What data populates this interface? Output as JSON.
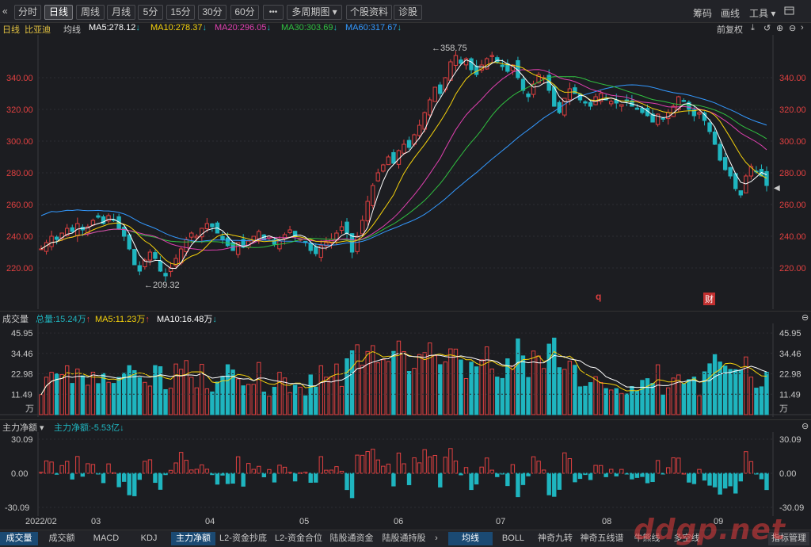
{
  "toolbar": {
    "collapse_icon": "«",
    "periods": [
      "分时",
      "日线",
      "周线",
      "月线",
      "5分",
      "15分",
      "30分",
      "60分"
    ],
    "more_label": "•••",
    "multi_period": "多周期图 ▾",
    "stock_info": "个股资料",
    "diagnose": "诊股",
    "right_tools": [
      "筹码",
      "画线",
      "工具 ▾"
    ]
  },
  "info": {
    "period": "日线",
    "name": "比亚迪",
    "avg": "均线",
    "ma5": "MA5:278.12",
    "ma10": "MA10:278.37",
    "ma20": "MA20:296.05",
    "ma30": "MA30:303.69",
    "ma60": "MA60:317.67",
    "adjust": "前复权"
  },
  "colors": {
    "up": "#e04040",
    "down": "#1fb5bf",
    "ma5": "#ffffff",
    "ma10": "#f5d20c",
    "ma20": "#e040b0",
    "ma30": "#30c040",
    "ma60": "#3399ff"
  },
  "price_axis": {
    "ticks": [
      "340.00",
      "320.00",
      "300.00",
      "280.00",
      "260.00",
      "240.00",
      "220.00"
    ],
    "high_label": "358.75",
    "low_label": "209.32"
  },
  "markers": {
    "m1": "q",
    "m2": "财"
  },
  "volume": {
    "title": "成交量",
    "total": "总量:15.24万",
    "ma5": "MA5:11.23万",
    "ma10": "MA10:16.48万",
    "ticks": [
      "45.95",
      "34.46",
      "22.98",
      "11.49",
      "万"
    ]
  },
  "flow": {
    "title": "主力净额 ▾",
    "value": "主力净额:-5.53亿",
    "ticks": [
      "30.09",
      "0.00",
      "-30.09"
    ]
  },
  "xaxis": [
    "2022/02",
    "03",
    "04",
    "05",
    "06",
    "07",
    "08",
    "09"
  ],
  "bottom_tabs_left": [
    "成交量",
    "成交额",
    "MACD",
    "KDJ",
    "主力净额",
    "L2-资金抄底",
    "L2-资金合位",
    "陆股通资金",
    "陆股通持股"
  ],
  "bottom_tabs_right": [
    "均线",
    "BOLL",
    "神奇九转",
    "神奇五线谱",
    "牛熊线",
    "多空线"
  ],
  "indicator_mgr": "指标管理",
  "watermark": "ddgp.net",
  "chart_data": {
    "type": "candlestick",
    "ylim": [
      200,
      365
    ],
    "series_closes": [
      232,
      236,
      240,
      238,
      242,
      245,
      243,
      248,
      244,
      246,
      250,
      252,
      248,
      253,
      250,
      245,
      240,
      232,
      222,
      218,
      225,
      230,
      226,
      218,
      215,
      220,
      226,
      232,
      238,
      242,
      240,
      245,
      248,
      246,
      242,
      238,
      234,
      231,
      236,
      233,
      237,
      240,
      243,
      238,
      240,
      235,
      237,
      241,
      244,
      240,
      238,
      236,
      231,
      229,
      234,
      236,
      238,
      242,
      246,
      242,
      230,
      240,
      250,
      262,
      272,
      280,
      285,
      290,
      286,
      294,
      298,
      296,
      304,
      310,
      318,
      326,
      334,
      330,
      340,
      350,
      354,
      349,
      352,
      345,
      342,
      348,
      352,
      354,
      350,
      347,
      344,
      348,
      340,
      332,
      328,
      336,
      342,
      340,
      332,
      322,
      318,
      327,
      333,
      330,
      326,
      324,
      322,
      328,
      330,
      326,
      325,
      324,
      323,
      325,
      322,
      320,
      318,
      316,
      312,
      317,
      314,
      318,
      322,
      328,
      325,
      320,
      316,
      318,
      313,
      306,
      298,
      288,
      282,
      278,
      270,
      266,
      278,
      284,
      281,
      278,
      272
    ]
  }
}
